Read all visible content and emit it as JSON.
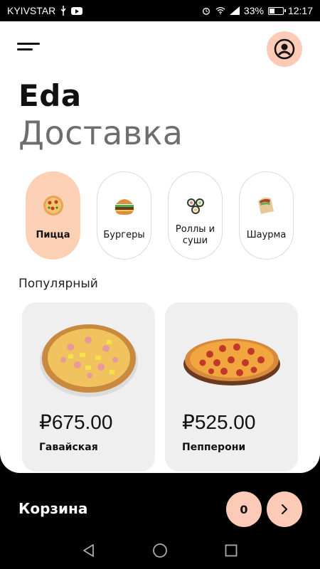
{
  "status_bar": {
    "carrier": "KYIVSTAR",
    "battery": "33%",
    "battery_level": 0.33,
    "time": "12:17"
  },
  "header": {
    "title_bold": "Eda",
    "title_light": "Доставка"
  },
  "categories": [
    {
      "label": "Пицца",
      "icon": "pizza-icon",
      "active": true
    },
    {
      "label": "Бургеры",
      "icon": "burger-icon",
      "active": false
    },
    {
      "label": "Роллы и суши",
      "icon": "sushi-icon",
      "active": false
    },
    {
      "label": "Шаурма",
      "icon": "shawarma-icon",
      "active": false
    }
  ],
  "popular": {
    "title": "Популярный",
    "items": [
      {
        "price": "₽675.00",
        "name": "Гавайская",
        "image": "hawaiian-pizza-image"
      },
      {
        "price": "₽525.00",
        "name": "Пепперони",
        "image": "pepperoni-pizza-image"
      }
    ]
  },
  "cart": {
    "label": "Корзина",
    "count": "0"
  },
  "colors": {
    "accent": "#fccab7",
    "active_category": "#fcd0b4",
    "card_bg": "#efefef"
  }
}
